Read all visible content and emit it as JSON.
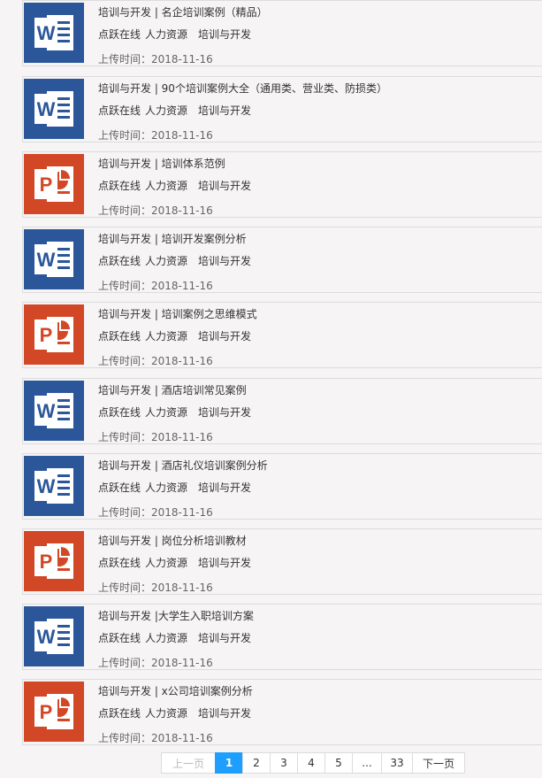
{
  "items": [
    {
      "type": "word",
      "icon": "word-doc-icon",
      "title": "培训与开发 | 名企培训案例（精品）",
      "tag1": "点跃在线",
      "tag2": "人力资源",
      "tag3": "培训与开发",
      "date": "上传时间：2018-11-16"
    },
    {
      "type": "word",
      "icon": "word-doc-icon",
      "title": "培训与开发 | 90个培训案例大全（通用类、营业类、防损类）",
      "tag1": "点跃在线",
      "tag2": "人力资源",
      "tag3": "培训与开发",
      "date": "上传时间：2018-11-16"
    },
    {
      "type": "ppt",
      "icon": "powerpoint-doc-icon",
      "title": "培训与开发 | 培训体系范例",
      "tag1": "点跃在线",
      "tag2": "人力资源",
      "tag3": "培训与开发",
      "date": "上传时间：2018-11-16"
    },
    {
      "type": "word",
      "icon": "word-doc-icon",
      "title": "培训与开发 | 培训开发案例分析",
      "tag1": "点跃在线",
      "tag2": "人力资源",
      "tag3": "培训与开发",
      "date": "上传时间：2018-11-16"
    },
    {
      "type": "ppt",
      "icon": "powerpoint-doc-icon",
      "title": "培训与开发 | 培训案例之思维模式",
      "tag1": "点跃在线",
      "tag2": "人力资源",
      "tag3": "培训与开发",
      "date": "上传时间：2018-11-16"
    },
    {
      "type": "word",
      "icon": "word-doc-icon",
      "title": "培训与开发 | 酒店培训常见案例",
      "tag1": "点跃在线",
      "tag2": "人力资源",
      "tag3": "培训与开发",
      "date": "上传时间：2018-11-16"
    },
    {
      "type": "word",
      "icon": "word-doc-icon",
      "title": "培训与开发 | 酒店礼仪培训案例分析",
      "tag1": "点跃在线",
      "tag2": "人力资源",
      "tag3": "培训与开发",
      "date": "上传时间：2018-11-16"
    },
    {
      "type": "ppt",
      "icon": "powerpoint-doc-icon",
      "title": "培训与开发 | 岗位分析培训教材",
      "tag1": "点跃在线",
      "tag2": "人力资源",
      "tag3": "培训与开发",
      "date": "上传时间：2018-11-16"
    },
    {
      "type": "word",
      "icon": "word-doc-icon",
      "title": "培训与开发 |大学生入职培训方案",
      "tag1": "点跃在线",
      "tag2": "人力资源",
      "tag3": "培训与开发",
      "date": "上传时间：2018-11-16"
    },
    {
      "type": "ppt",
      "icon": "powerpoint-doc-icon",
      "title": "培训与开发 | x公司培训案例分析",
      "tag1": "点跃在线",
      "tag2": "人力资源",
      "tag3": "培训与开发",
      "date": "上传时间：2018-11-16"
    }
  ],
  "pagination": {
    "prev": "上一页",
    "pages": [
      "1",
      "2",
      "3",
      "4",
      "5",
      "...",
      "33"
    ],
    "current": "1",
    "next": "下一页"
  },
  "colors": {
    "word": "#2b579a",
    "ppt": "#d24726",
    "active_page": "#1e9fff"
  }
}
